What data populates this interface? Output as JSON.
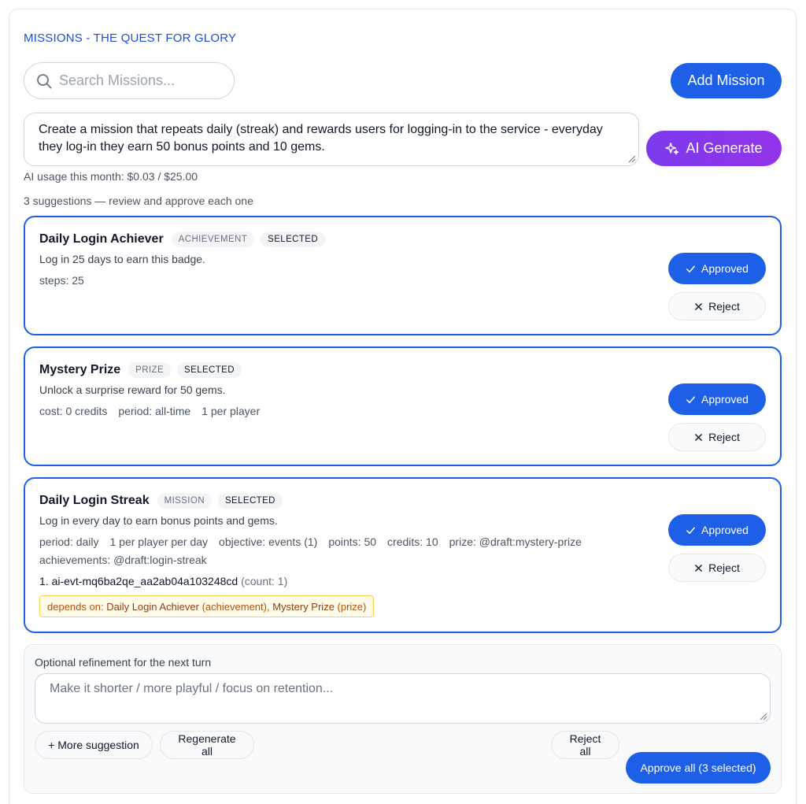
{
  "header": {
    "title": "MISSIONS - THE QUEST FOR GLORY"
  },
  "search": {
    "placeholder": "Search Missions..."
  },
  "add_mission_label": "Add Mission",
  "prompt": {
    "value": "Create a mission that repeats daily (streak) and rewards users for logging-in to the service - everyday they log-in they earn 50 bonus points and 10 gems."
  },
  "ai_generate_label": "AI Generate",
  "usage_text": "AI usage this month: $0.03 / $25.00",
  "suggestions_text": "3 suggestions — review and approve each one",
  "cards": [
    {
      "title": "Daily Login Achiever",
      "type_tag": "ACHIEVEMENT",
      "selected_tag": "SELECTED",
      "description": "Log in 25 days to earn this badge.",
      "meta": [
        "steps: 25"
      ],
      "approved_label": "Approved",
      "reject_label": "Reject"
    },
    {
      "title": "Mystery Prize",
      "type_tag": "PRIZE",
      "selected_tag": "SELECTED",
      "description": "Unlock a surprise reward for 50 gems.",
      "meta": [
        "cost: 0 credits",
        "period: all-time",
        "1 per player"
      ],
      "approved_label": "Approved",
      "reject_label": "Reject"
    },
    {
      "title": "Daily Login Streak",
      "type_tag": "MISSION",
      "selected_tag": "SELECTED",
      "description": "Log in every day to earn bonus points and gems.",
      "meta": [
        "period: daily",
        "1 per player per day",
        "objective: events (1)",
        "points: 50",
        "credits: 10",
        "prize: @draft:mystery-prize"
      ],
      "meta2": "achievements: @draft:login-streak",
      "event": "1. ai-evt-mq6ba2qe_aa2ab04a103248cd",
      "event_count": "(count: 1)",
      "depends_prefix": "depends on: ",
      "depends_a": "Daily Login Achiever",
      "depends_a_type": " (achievement), ",
      "depends_b": "Mystery Prize",
      "depends_b_type": " (prize)",
      "approved_label": "Approved",
      "reject_label": "Reject"
    }
  ],
  "refinement": {
    "label": "Optional refinement for the next turn",
    "placeholder": "Make it shorter / more playful / focus on retention...",
    "more_label": "+ More suggestion",
    "regen_label": "Regenerate all",
    "reject_all_label": "Reject all",
    "approve_all_label": "Approve all (3 selected)"
  },
  "colors": {
    "primary": "#1d5fe6",
    "ai_purple": "#8b3cf0",
    "title_blue": "#1d4ed8"
  }
}
